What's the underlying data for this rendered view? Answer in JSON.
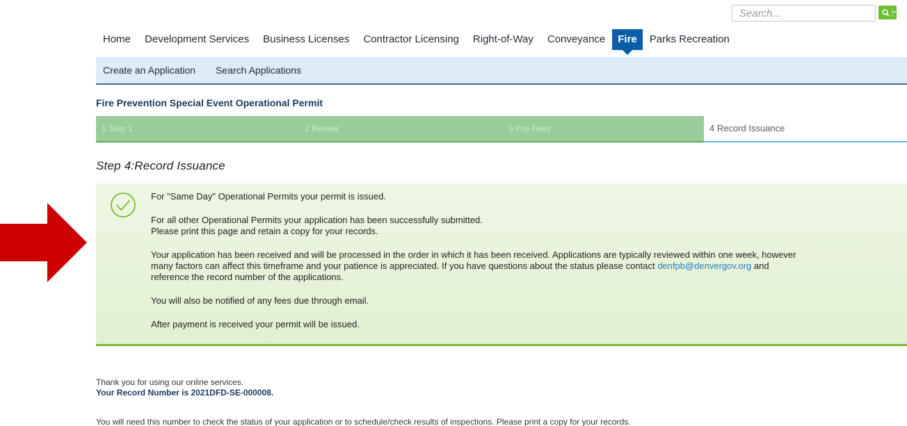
{
  "search": {
    "placeholder": "Search..."
  },
  "topnav": {
    "items": [
      "Home",
      "Development Services",
      "Business Licenses",
      "Contractor Licensing",
      "Right-of-Way",
      "Conveyance",
      "Fire",
      "Parks Recreation"
    ],
    "active": "Fire"
  },
  "subnav": {
    "items": [
      "Create an Application",
      "Search Applications"
    ]
  },
  "permit_title": "Fire Prevention Special Event Operational Permit",
  "steps": [
    {
      "label": "1 Step 1",
      "status": "complete"
    },
    {
      "label": "2 Review",
      "status": "complete"
    },
    {
      "label": "3 Pay Fees",
      "status": "complete"
    },
    {
      "label": "4 Record Issuance",
      "status": "current"
    }
  ],
  "step_heading": "Step 4:Record Issuance",
  "success": {
    "line1": "For \"Same Day\" Operational Permits your permit is issued.",
    "line2a": "For all other Operational Permits your application has been successfully submitted.",
    "line2b": "Please print this page and retain a copy for your records.",
    "line3a": "Your application has been received and will be processed in the order in which it has been received. Applications are typically reviewed within one week, however",
    "line3b": "many factors can affect this timeframe and your patience is appreciated. If you have questions about the status please contact ",
    "email": "denfpb@denvergov.org",
    "line3b_tail": " and",
    "line3c": "reference the record number of the applications.",
    "line4": "You will also be notified of any fees due through email.",
    "line5": "After payment is received your permit will be issued."
  },
  "footer": {
    "thanks": "Thank you for using our online services.",
    "record": "Your Record Number is 2021DFD-SE-000008.",
    "note": "You will need this number to check the status of your application or to schedule/check results of inspections. Please print a copy for your records."
  },
  "colors": {
    "active_nav": "#0a5ea8",
    "subnav_bg": "#dcecf8",
    "step_done": "#99cc99",
    "success_bg": "#e6f2d8",
    "success_border": "#77bb33",
    "arrow": "#cc0000",
    "link": "#1b7fc4"
  },
  "icons": {
    "search": "search-icon",
    "success": "check-circle-icon",
    "arrow": "right-arrow-icon"
  }
}
